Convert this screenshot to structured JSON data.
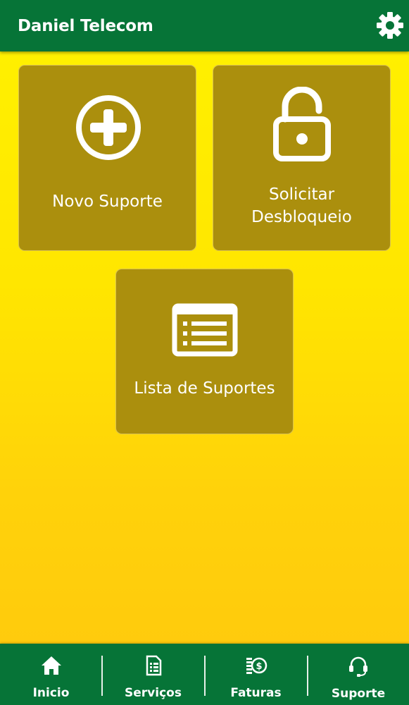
{
  "header": {
    "title": "Daniel Telecom",
    "settings_icon": "gear-icon"
  },
  "tiles": [
    {
      "label": "Novo Suporte",
      "icon": "plus-circle-icon"
    },
    {
      "label_line1": "Solicitar",
      "label_line2": "Desbloqueio",
      "icon": "unlock-icon"
    },
    {
      "label": "Lista de Suportes",
      "icon": "list-icon"
    }
  ],
  "bottom_nav": [
    {
      "label": "Inicio",
      "icon": "home-icon"
    },
    {
      "label": "Serviços",
      "icon": "document-icon"
    },
    {
      "label": "Faturas",
      "icon": "money-icon"
    },
    {
      "label": "Suporte",
      "icon": "headset-icon"
    }
  ],
  "colors": {
    "bar_green": "#067437",
    "tile": "#ab8f0d",
    "background_top": "#fff200",
    "background_bottom": "#ffc80e"
  }
}
